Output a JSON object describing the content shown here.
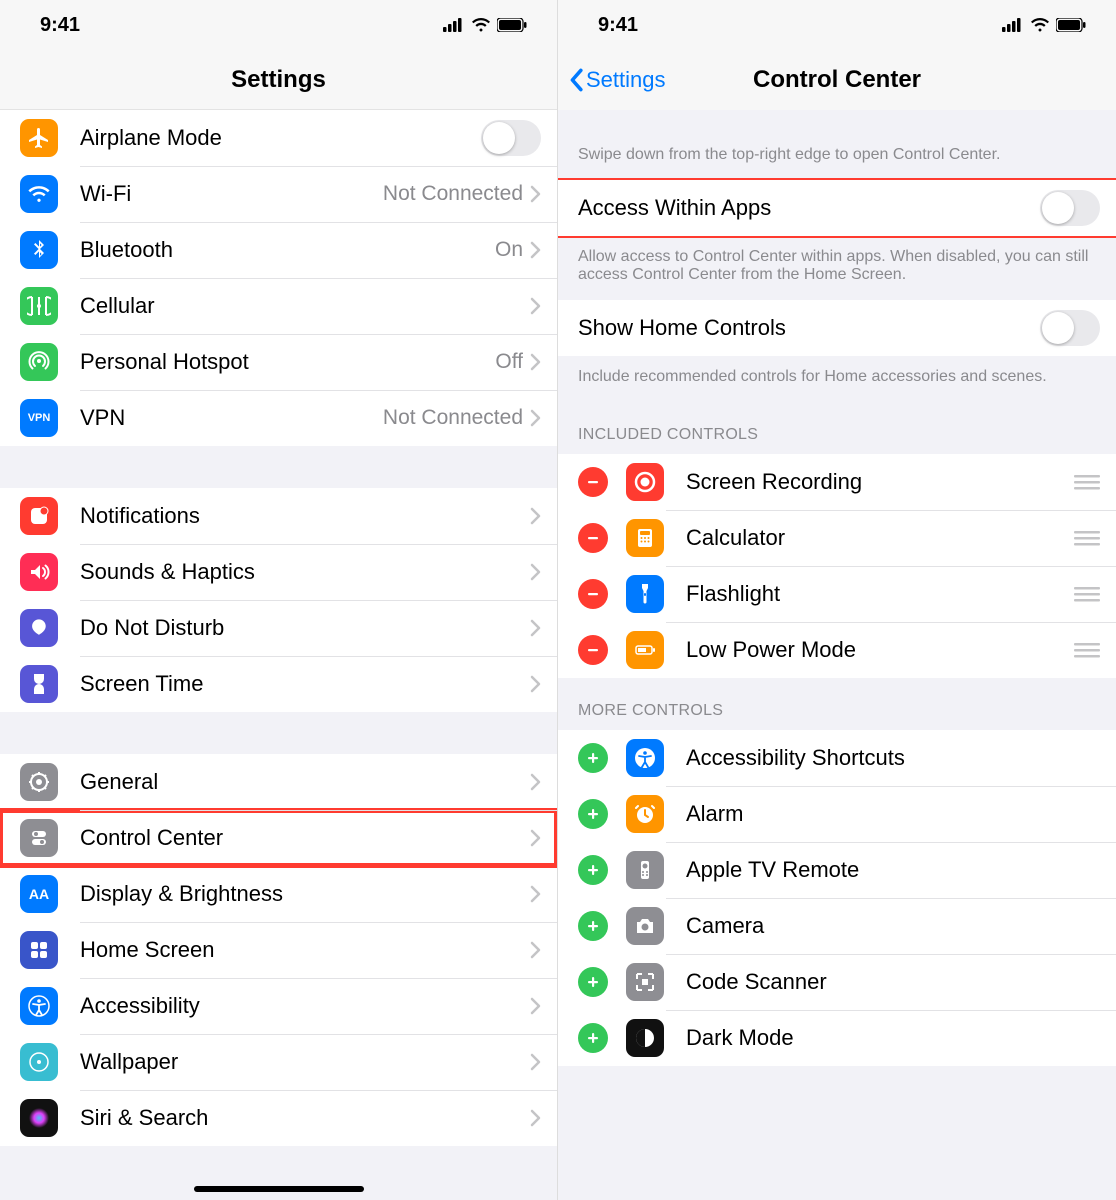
{
  "status": {
    "time": "9:41"
  },
  "left": {
    "title": "Settings",
    "groups": [
      [
        {
          "key": "airplane",
          "label": "Airplane Mode",
          "type": "toggle",
          "on": false,
          "color": "#ff9500"
        },
        {
          "key": "wifi",
          "label": "Wi-Fi",
          "value": "Not Connected",
          "color": "#007aff"
        },
        {
          "key": "bluetooth",
          "label": "Bluetooth",
          "value": "On",
          "color": "#007aff"
        },
        {
          "key": "cellular",
          "label": "Cellular",
          "color": "#34c759"
        },
        {
          "key": "hotspot",
          "label": "Personal Hotspot",
          "value": "Off",
          "color": "#34c759"
        },
        {
          "key": "vpn",
          "label": "VPN",
          "value": "Not Connected",
          "color": "#007aff",
          "text_icon": "VPN"
        }
      ],
      [
        {
          "key": "notifications",
          "label": "Notifications",
          "color": "#ff3b30"
        },
        {
          "key": "sounds",
          "label": "Sounds & Haptics",
          "color": "#ff2d55"
        },
        {
          "key": "dnd",
          "label": "Do Not Disturb",
          "color": "#5856d6"
        },
        {
          "key": "screentime",
          "label": "Screen Time",
          "color": "#5856d6"
        }
      ],
      [
        {
          "key": "general",
          "label": "General",
          "color": "#8e8e93"
        },
        {
          "key": "controlcenter",
          "label": "Control Center",
          "color": "#8e8e93",
          "highlight": true
        },
        {
          "key": "display",
          "label": "Display & Brightness",
          "color": "#007aff",
          "text_icon": "AA"
        },
        {
          "key": "homescreen",
          "label": "Home Screen",
          "color": "#3955c9"
        },
        {
          "key": "accessibility",
          "label": "Accessibility",
          "color": "#007aff"
        },
        {
          "key": "wallpaper",
          "label": "Wallpaper",
          "color": "#38bdd1"
        },
        {
          "key": "siri",
          "label": "Siri & Search",
          "color": "#111"
        }
      ]
    ]
  },
  "right": {
    "back": "Settings",
    "title": "Control Center",
    "intro": "Swipe down from the top-right edge to open Control Center.",
    "access": {
      "label": "Access Within Apps",
      "on": false,
      "footer": "Allow access to Control Center within apps. When disabled, you can still access Control Center from the Home Screen."
    },
    "home": {
      "label": "Show Home Controls",
      "on": false,
      "footer": "Include recommended controls for Home accessories and scenes."
    },
    "included_header": "INCLUDED CONTROLS",
    "included": [
      {
        "key": "screenrec",
        "label": "Screen Recording",
        "color": "#ff3b30"
      },
      {
        "key": "calculator",
        "label": "Calculator",
        "color": "#ff9500"
      },
      {
        "key": "flashlight",
        "label": "Flashlight",
        "color": "#007aff"
      },
      {
        "key": "lowpower",
        "label": "Low Power Mode",
        "color": "#ff9500"
      }
    ],
    "more_header": "MORE CONTROLS",
    "more": [
      {
        "key": "a11y",
        "label": "Accessibility Shortcuts",
        "color": "#007aff"
      },
      {
        "key": "alarm",
        "label": "Alarm",
        "color": "#ff9500"
      },
      {
        "key": "appletv",
        "label": "Apple TV Remote",
        "color": "#8e8e93"
      },
      {
        "key": "camera",
        "label": "Camera",
        "color": "#8e8e93"
      },
      {
        "key": "codescanner",
        "label": "Code Scanner",
        "color": "#8e8e93"
      },
      {
        "key": "darkmode",
        "label": "Dark Mode",
        "color": "#111"
      }
    ]
  }
}
